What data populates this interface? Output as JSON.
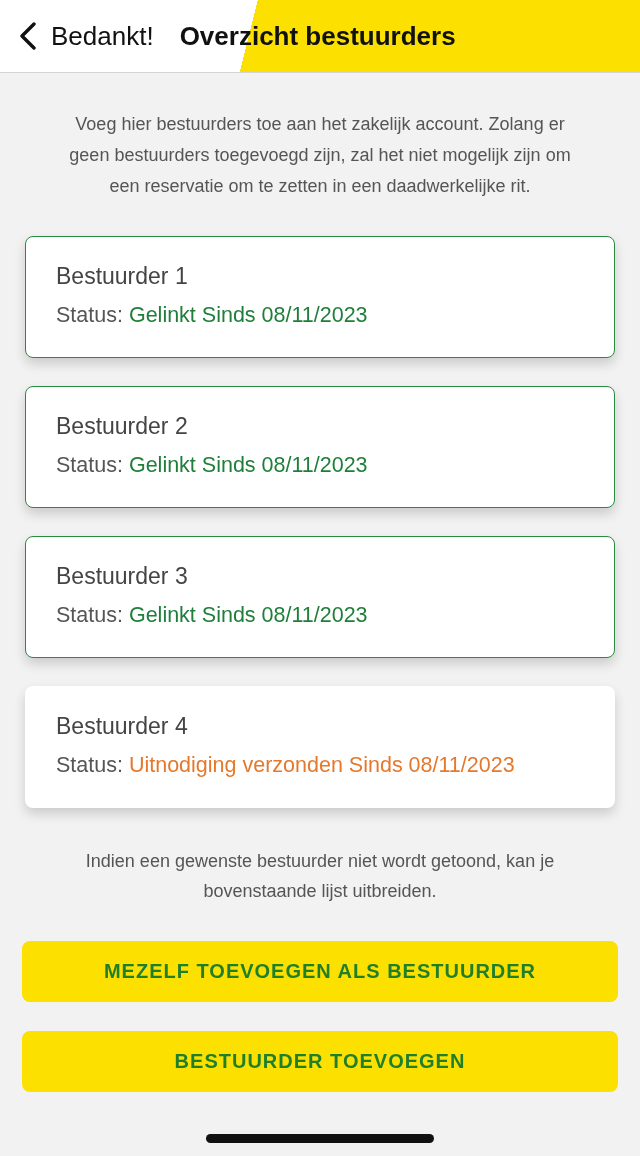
{
  "header": {
    "back_label": "Bedankt!",
    "title": "Overzicht bestuurders"
  },
  "intro": "Voeg hier bestuurders toe aan het zakelijk account. Zolang er geen bestuurders toegevoegd zijn, zal het niet mogelijk zijn om een reservatie om te zetten in een daadwerkelijke rit.",
  "drivers": [
    {
      "name": "Bestuurder 1",
      "status_label": "Status:",
      "status": "Gelinkt Sinds 08/11/2023",
      "kind": "linked"
    },
    {
      "name": "Bestuurder 2",
      "status_label": "Status:",
      "status": "Gelinkt Sinds 08/11/2023",
      "kind": "linked"
    },
    {
      "name": "Bestuurder 3",
      "status_label": "Status:",
      "status": "Gelinkt Sinds 08/11/2023",
      "kind": "linked"
    },
    {
      "name": "Bestuurder 4",
      "status_label": "Status:",
      "status": "Uitnodiging verzonden Sinds 08/11/2023",
      "kind": "invited"
    }
  ],
  "footer_note": "Indien een gewenste bestuurder niet wordt getoond, kan je bovenstaande lijst uitbreiden.",
  "buttons": [
    {
      "label": "MEZELF TOEVOEGEN ALS BESTUURDER"
    },
    {
      "label": "BESTUURDER TOEVOEGEN"
    }
  ]
}
